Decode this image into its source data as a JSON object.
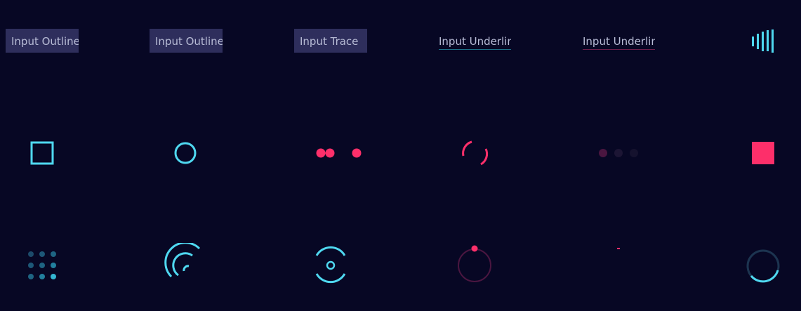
{
  "inputs": [
    {
      "label": "Input Outline",
      "style": "outline"
    },
    {
      "label": "Input Outline",
      "style": "outline"
    },
    {
      "label": "Input Trace",
      "style": "trace"
    },
    {
      "label": "Input Underline",
      "style": "underline",
      "underline_color": "#1d6f86"
    },
    {
      "label": "Input Underline",
      "style": "underline",
      "underline_color": "#6b1f4b"
    }
  ],
  "loaders": {
    "row1": [
      "bars-icon"
    ],
    "row2": [
      "square-outline-icon",
      "circle-outline-icon",
      "dots-bounce-icon",
      "arc-spinner-icon",
      "dots-fade-icon",
      "square-fill-icon"
    ],
    "row3": [
      "dot-grid-icon",
      "spiral-arcs-icon",
      "orbit-arcs-icon",
      "orbit-dot-icon",
      "small-dash-icon",
      "ring-progress-icon"
    ]
  },
  "colors": {
    "background": "#070724",
    "input_bg": "#2e2e5c",
    "text": "#b8bcd6",
    "cyan": "#4fd8f0",
    "pink": "#fd2f6a",
    "dark_pink": "#4a1640",
    "dark_teal": "#1c4a6a"
  }
}
